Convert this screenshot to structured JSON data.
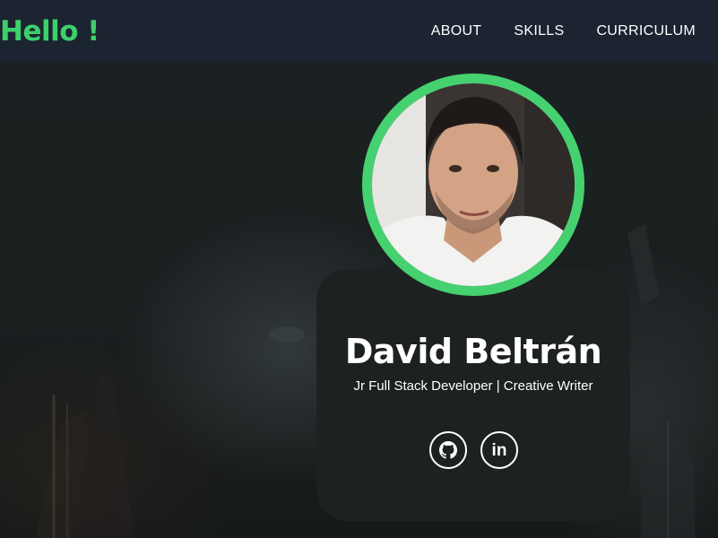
{
  "navbar": {
    "brand": "Hello !",
    "links": [
      "ABOUT",
      "SKILLS",
      "CURRICULUM"
    ]
  },
  "profile": {
    "name": "David Beltrán",
    "role": "Jr Full Stack Developer | Creative Writer"
  },
  "social": {
    "github_icon": "github-icon",
    "linkedin_icon": "linkedin-icon",
    "linkedin_glyph": "in"
  },
  "colors": {
    "accent": "#3ecf6b",
    "navbar": "#1b2430",
    "background": "#1a1e1f",
    "card": "#1d2122",
    "text": "#ffffff"
  }
}
